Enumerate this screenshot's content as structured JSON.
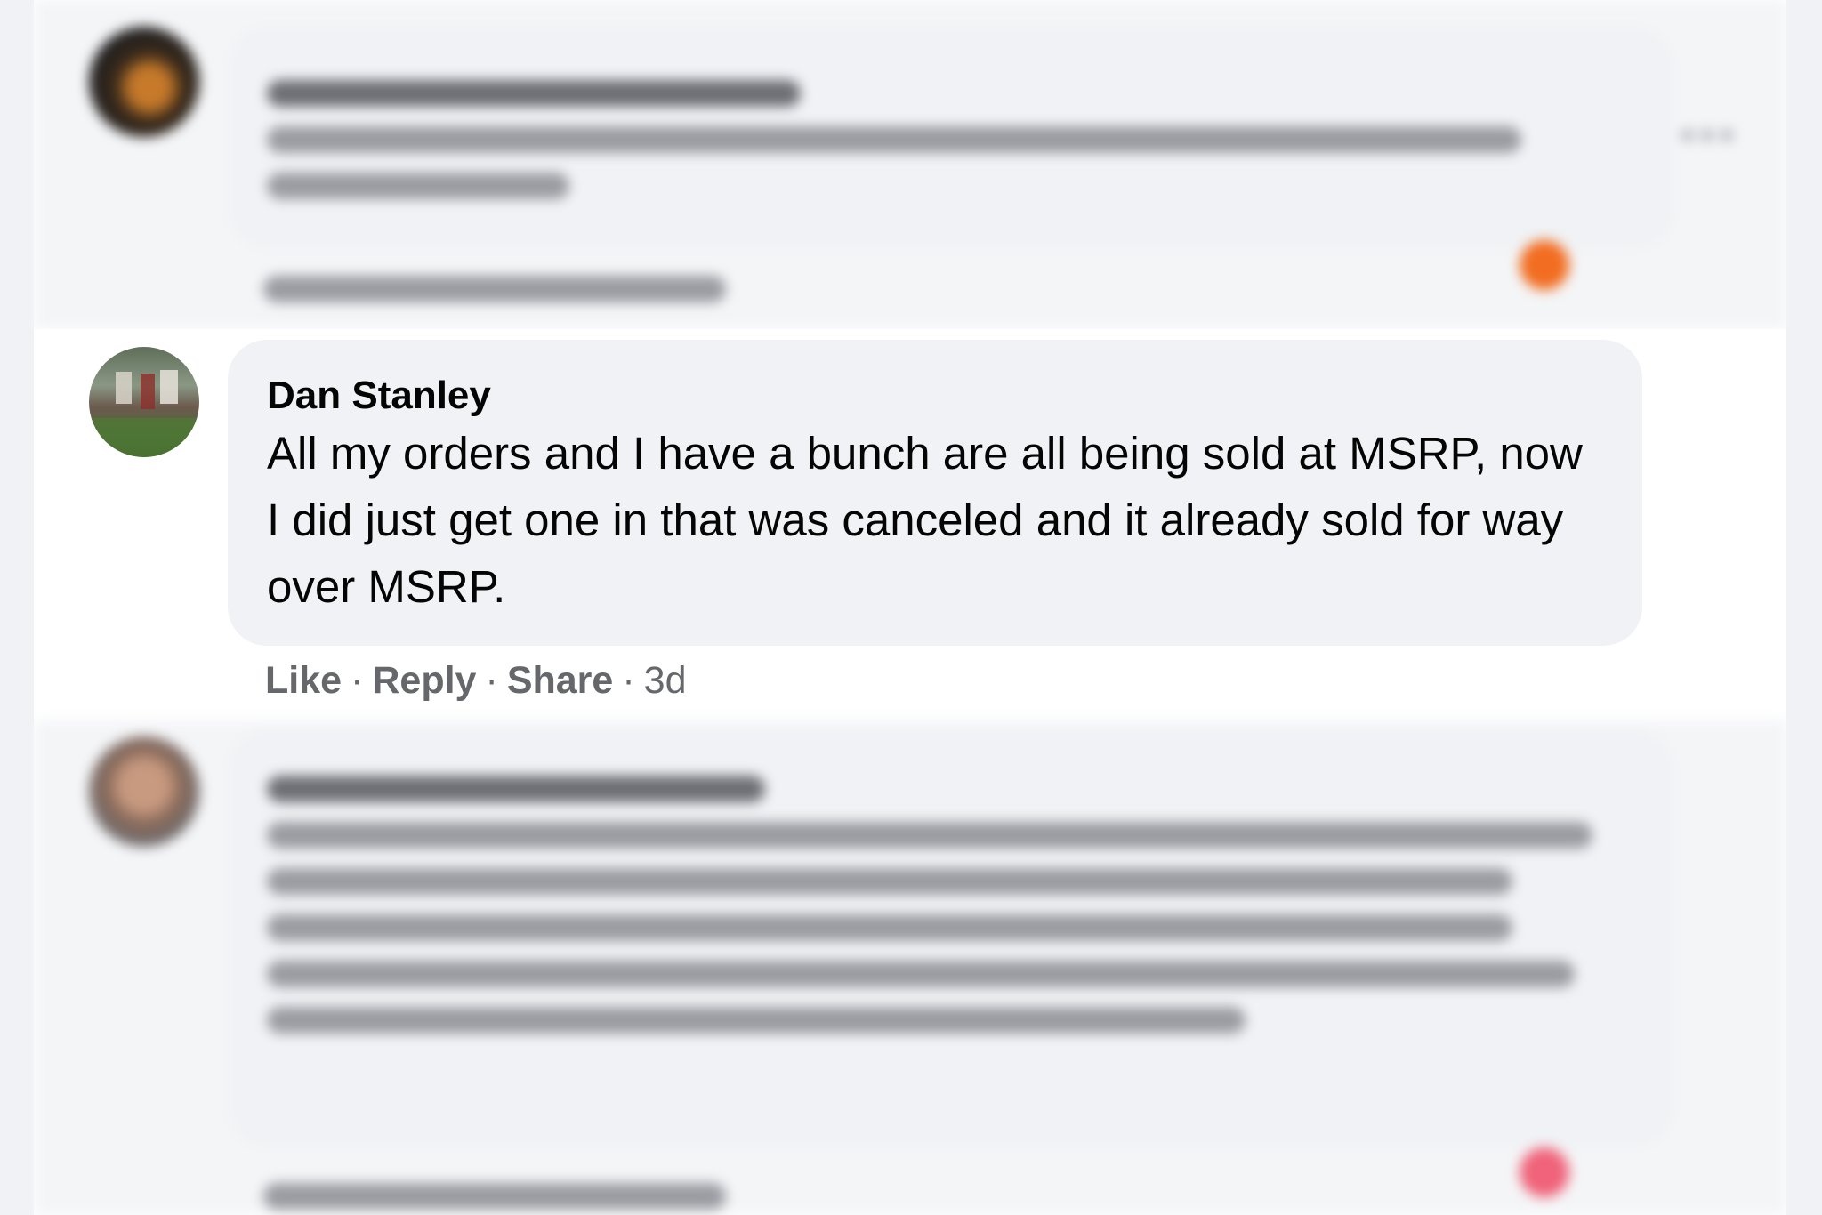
{
  "comments": [
    {
      "author": "",
      "text": "",
      "actions": {
        "like": "",
        "reply": "",
        "share": "",
        "time": ""
      },
      "blurred": true,
      "reaction_color": "#f26d21"
    },
    {
      "author": "Dan Stanley",
      "text": "All my orders and I have a bunch are all being sold at MSRP, now I did just get one in that was canceled and it already sold for way over MSRP.",
      "actions": {
        "like": "Like",
        "reply": "Reply",
        "share": "Share",
        "time": "3d",
        "separator": "·"
      },
      "blurred": false
    },
    {
      "author": "",
      "text": "",
      "actions": {
        "like": "",
        "reply": "",
        "share": "",
        "time": ""
      },
      "blurred": true,
      "reaction_color": "#f0637a"
    }
  ],
  "colors": {
    "page_bg": "#f0f2f5",
    "bubble_bg": "#f0f2f5",
    "text": "#050505",
    "secondary_text": "#65676b"
  }
}
